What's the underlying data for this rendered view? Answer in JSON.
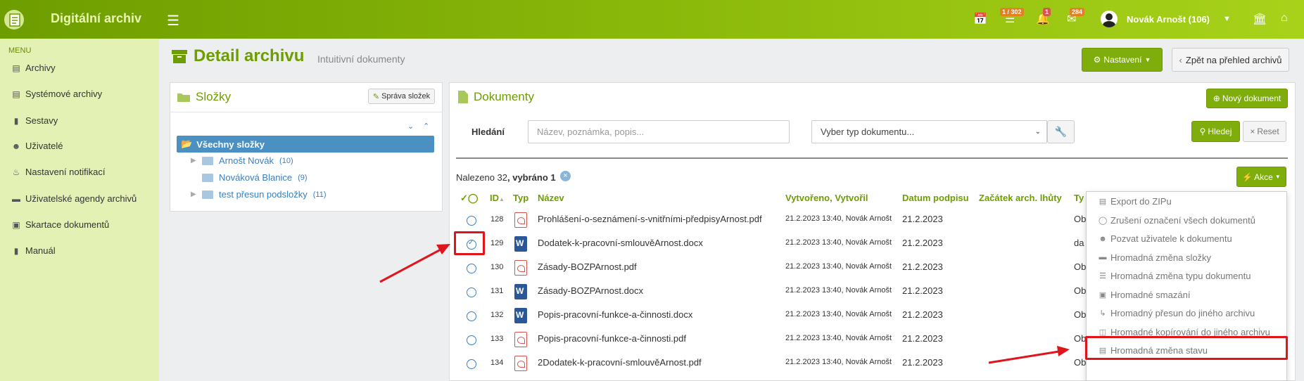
{
  "app": {
    "title": "Digitální archiv",
    "user_name": "Novák Arnošt (106)",
    "badges": {
      "tasks": "1 / 302",
      "notifications": "1",
      "messages": "284"
    }
  },
  "sidebar": {
    "menu_label": "MENU",
    "items": [
      {
        "label": "Archivy",
        "icon": "archive-icon"
      },
      {
        "label": "Systémové archivy",
        "icon": "archive-icon"
      },
      {
        "label": "Sestavy",
        "icon": "book-icon"
      },
      {
        "label": "Uživatelé",
        "icon": "users-icon"
      },
      {
        "label": "Nastavení notifikací",
        "icon": "bell-icon"
      },
      {
        "label": "Uživatelské agendy archivů",
        "icon": "folder-open-icon"
      },
      {
        "label": "Skartace dokumentů",
        "icon": "trash-icon"
      },
      {
        "label": "Manuál",
        "icon": "book-icon"
      }
    ]
  },
  "page": {
    "title": "Detail archivu",
    "subtitle": "Intuitivní dokumenty",
    "settings_button": "Nastavení",
    "back_button": "Zpět na přehled archivů"
  },
  "folders": {
    "title": "Složky",
    "manage_button": "Správa složek",
    "root": "Všechny složky",
    "items": [
      {
        "name": "Arnošt Novák",
        "count": "(10)"
      },
      {
        "name": "Nováková Blanice",
        "count": "(9)"
      },
      {
        "name": "test přesun podsložky",
        "count": "(11)"
      }
    ]
  },
  "documents": {
    "title": "Dokumenty",
    "new_button": "Nový dokument",
    "search_label": "Hledání",
    "search_placeholder": "Název, poznámka, popis...",
    "type_select": "Vyber typ dokumentu...",
    "search_button": "Hledej",
    "reset_button": "Reset",
    "found_text": "Nalezeno 32",
    "selected_text": ", vybráno 1",
    "actions_button": "Akce",
    "columns": {
      "id": "ID",
      "type": "Typ",
      "name": "Název",
      "created": "Vytvořeno, Vytvořil",
      "signed": "Datum podpisu",
      "retention_start": "Začátek arch. lhůty",
      "doc_type": "Ty"
    },
    "rows": [
      {
        "id": "128",
        "type": "pdf",
        "name": "Prohlášení-o-seznámení-s-vnitřními-předpisyArnost.pdf",
        "created": "21.2.2023 13:40, Novák Arnošt",
        "signed": "21.2.2023",
        "doc_type": "Ob"
      },
      {
        "id": "129",
        "type": "doc",
        "name": "Dodatek-k-pracovní-smlouvěArnost.docx",
        "created": "21.2.2023 13:40, Novák Arnošt",
        "signed": "21.2.2023",
        "doc_type": "da"
      },
      {
        "id": "130",
        "type": "pdf",
        "name": "Zásady-BOZPArnost.pdf",
        "created": "21.2.2023 13:40, Novák Arnošt",
        "signed": "21.2.2023",
        "doc_type": "Ob"
      },
      {
        "id": "131",
        "type": "doc",
        "name": "Zásady-BOZPArnost.docx",
        "created": "21.2.2023 13:40, Novák Arnošt",
        "signed": "21.2.2023",
        "doc_type": "Ob"
      },
      {
        "id": "132",
        "type": "doc",
        "name": "Popis-pracovní-funkce-a-činnosti.docx",
        "created": "21.2.2023 13:40, Novák Arnošt",
        "signed": "21.2.2023",
        "doc_type": "Ob"
      },
      {
        "id": "133",
        "type": "pdf",
        "name": "Popis-pracovní-funkce-a-činnosti.pdf",
        "created": "21.2.2023 13:40, Novák Arnošt",
        "signed": "21.2.2023",
        "doc_type": "Ob"
      },
      {
        "id": "134",
        "type": "pdf",
        "name": "2Dodatek-k-pracovní-smlouvěArnost.pdf",
        "created": "21.2.2023 13:40, Novák Arnošt",
        "signed": "21.2.2023",
        "doc_type": "Obecný dokument"
      }
    ]
  },
  "actions_menu": [
    {
      "label": "Export do ZIPu",
      "icon": "file-zip-icon"
    },
    {
      "label": "Zrušení označení všech dokumentů",
      "icon": "circle-icon"
    },
    {
      "label": "Pozvat uživatele k dokumentu",
      "icon": "user-icon"
    },
    {
      "label": "Hromadná změna složky",
      "icon": "folder-icon"
    },
    {
      "label": "Hromadná změna typu dokumentu",
      "icon": "list-icon"
    },
    {
      "label": "Hromadné smazání",
      "icon": "trash-icon"
    },
    {
      "label": "Hromadný přesun do jiného archivu",
      "icon": "move-arrow-icon"
    },
    {
      "label": "Hromadné kopírování do jiného archivu",
      "icon": "copy-icon"
    },
    {
      "label": "Hromadná změna stavu",
      "icon": "archive-icon"
    }
  ]
}
